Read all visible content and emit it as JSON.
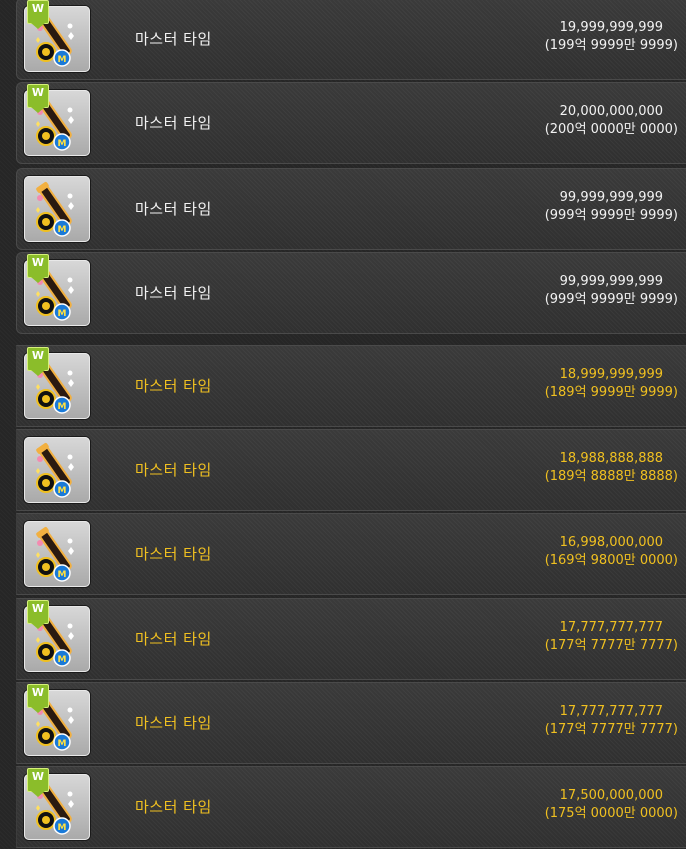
{
  "items": [
    {
      "w": true,
      "gold": false,
      "name": "마스터 타임",
      "price": "19,999,999,999",
      "price_kor": "(199억 9999만 9999)"
    },
    {
      "w": true,
      "gold": false,
      "name": "마스터 타임",
      "price": "20,000,000,000",
      "price_kor": "(200억 0000만 0000)"
    },
    {
      "w": false,
      "gold": false,
      "name": "마스터 타임",
      "price": "99,999,999,999",
      "price_kor": "(999억 9999만 9999)"
    },
    {
      "w": true,
      "gold": false,
      "name": "마스터 타임",
      "price": "99,999,999,999",
      "price_kor": "(999억 9999만 9999)"
    },
    {
      "w": true,
      "gold": true,
      "name": "마스터 타임",
      "price": "18,999,999,999",
      "price_kor": "(189억 9999만 9999)"
    },
    {
      "w": false,
      "gold": true,
      "name": "마스터 타임",
      "price": "18,988,888,888",
      "price_kor": "(189억 8888만 8888)"
    },
    {
      "w": false,
      "gold": true,
      "name": "마스터 타임",
      "price": "16,998,000,000",
      "price_kor": "(169억 9800만 0000)"
    },
    {
      "w": true,
      "gold": true,
      "name": "마스터 타임",
      "price": "17,777,777,777",
      "price_kor": "(177억 7777만 7777)"
    },
    {
      "w": true,
      "gold": true,
      "name": "마스터 타임",
      "price": "17,777,777,777",
      "price_kor": "(177억 7777만 7777)"
    },
    {
      "w": true,
      "gold": true,
      "name": "마스터 타임",
      "price": "17,500,000,000",
      "price_kor": "(175억 0000만 0000)"
    }
  ],
  "badge_label": "W",
  "colors": {
    "normal_text": "#f2f2f2",
    "highlight_text": "#f0c020",
    "badge": "#8bbd2a"
  }
}
